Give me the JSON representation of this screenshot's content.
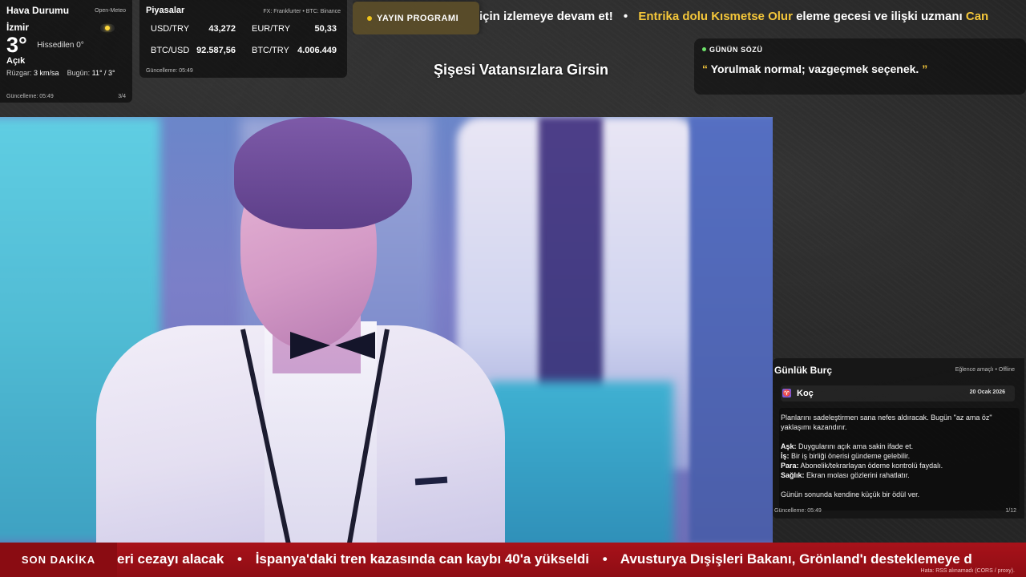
{
  "weather": {
    "title": "Hava Durumu",
    "source": "Open-Meteo",
    "city": "İzmir",
    "icon": "sun-icon",
    "temp": "3°",
    "feels_like": "Hissedilen 0°",
    "condition": "Açık",
    "wind_label": "Rüzgar:",
    "wind_value": "3 km/sa",
    "today_label": "Bugün:",
    "today_value": "11° / 3°",
    "updated": "Güncelleme: 05:49",
    "page": "3/4"
  },
  "markets": {
    "title": "Piyasalar",
    "source": "FX: Frankfurter • BTC: Binance",
    "rates": [
      {
        "pair": "USD/TRY",
        "value": "43,272"
      },
      {
        "pair": "EUR/TRY",
        "value": "50,33"
      },
      {
        "pair": "BTC/USD",
        "value": "92.587,56"
      },
      {
        "pair": "BTC/TRY",
        "value": "4.006.449"
      }
    ],
    "updated": "Güncelleme: 05:49"
  },
  "program": {
    "label": "YAYIN PROGRAMI",
    "ticker_prefix": "için izlemeye devam et!",
    "ticker_separator": "•",
    "ticker_highlight": "Entrika dolu Kısmetse Olur",
    "ticker_suffix": "eleme gecesi ve ilişki uzmanı",
    "ticker_tail": "Can"
  },
  "show_title": "Şişesi Vatansızlara Girsin",
  "quote": {
    "label": "GÜNÜN SÖZÜ",
    "open_mark": "“",
    "text": "Yorulmak normal; vazgeçmek seçenek.",
    "close_mark": "”"
  },
  "horoscope": {
    "title": "Günlük Burç",
    "note": "Eğlence amaçlı • Offline",
    "sign_symbol": "♈",
    "sign": "Koç",
    "date": "20 Ocak 2026",
    "intro": "Planlarını sadeleştirmen sana nefes aldıracak. Bugün \"az ama öz\" yaklaşımı kazandırır.",
    "love_label": "Aşk:",
    "love": "Duygularını açık ama sakin ifade et.",
    "work_label": "İş:",
    "work": "Bir iş birliği önerisi gündeme gelebilir.",
    "money_label": "Para:",
    "money": "Abonelik/tekrarlayan ödeme kontrolü faydalı.",
    "health_label": "Sağlık:",
    "health": "Ekran molası gözlerini rahatlatır.",
    "closing": "Günün sonunda kendine küçük bir ödül ver.",
    "updated": "Güncelleme: 05:49",
    "page": "1/12"
  },
  "breaking": {
    "label": "SON DAKİKA",
    "items": [
      "eri cezayı alacak",
      "İspanya'daki tren kazasında can kaybı 40'a yükseldi",
      "Avusturya Dışişleri Bakanı, Grönland'ı desteklemeye d"
    ],
    "separator": "•",
    "rss_error": "Hata: RSS alınamadı (CORS / proxy)."
  },
  "colors": {
    "accent_gold": "#f5c73a",
    "breaking_red": "#a8121a",
    "status_green": "#6ee36a"
  }
}
